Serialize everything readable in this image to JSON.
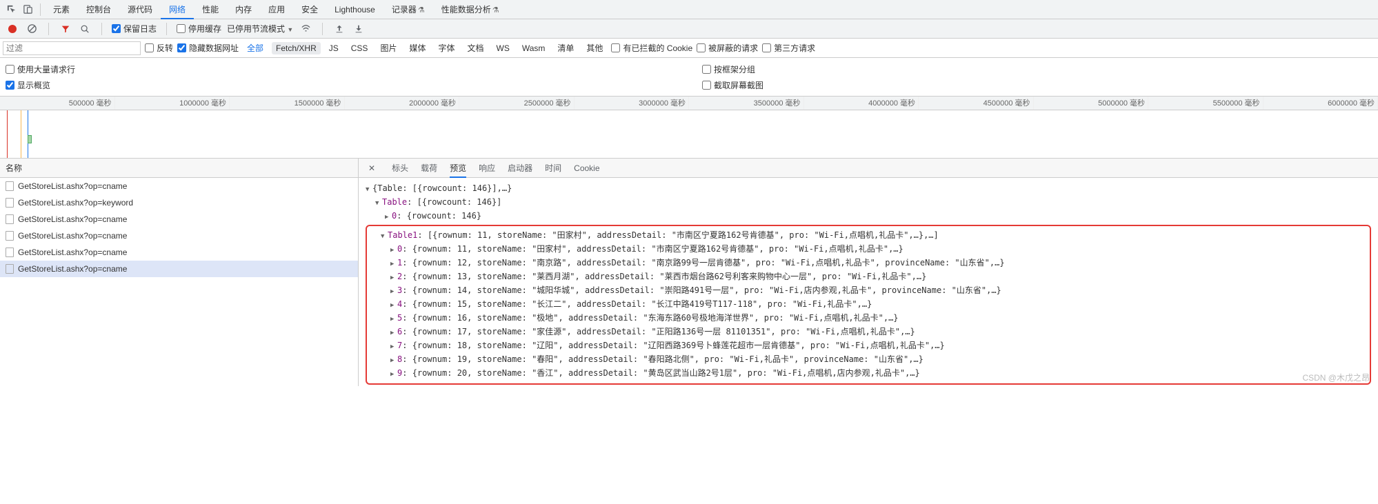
{
  "main_tabs": {
    "elements": "元素",
    "console": "控制台",
    "sources": "源代码",
    "network": "网络",
    "performance": "性能",
    "memory": "内存",
    "application": "应用",
    "security": "安全",
    "lighthouse": "Lighthouse",
    "recorder": "记录器",
    "perfinsights": "性能数据分析"
  },
  "subbar": {
    "preserve_log": "保留日志",
    "disable_cache": "停用缓存",
    "throttling": "已停用节流模式"
  },
  "filterbar": {
    "placeholder": "过滤",
    "invert": "反转",
    "hide_data_urls": "隐藏数据网址",
    "types": {
      "all": "全部",
      "fetch": "Fetch/XHR",
      "js": "JS",
      "css": "CSS",
      "img": "图片",
      "media": "媒体",
      "font": "字体",
      "doc": "文档",
      "ws": "WS",
      "wasm": "Wasm",
      "manifest": "清单",
      "other": "其他"
    },
    "blocked_cookies": "有已拦截的 Cookie",
    "blocked_requests": "被屏蔽的请求",
    "third_party": "第三方请求"
  },
  "options": {
    "large_rows": "使用大量请求行",
    "show_overview": "显示概览",
    "group_by_frame": "按框架分组",
    "screenshot": "截取屏幕截图"
  },
  "timeline": [
    "500000 毫秒",
    "1000000 毫秒",
    "1500000 毫秒",
    "2000000 毫秒",
    "2500000 毫秒",
    "3000000 毫秒",
    "3500000 毫秒",
    "4000000 毫秒",
    "4500000 毫秒",
    "5000000 毫秒",
    "5500000 毫秒",
    "6000000 毫秒"
  ],
  "left_header": "名称",
  "requests": [
    "GetStoreList.ashx?op=cname",
    "GetStoreList.ashx?op=keyword",
    "GetStoreList.ashx?op=cname",
    "GetStoreList.ashx?op=cname",
    "GetStoreList.ashx?op=cname",
    "GetStoreList.ashx?op=cname"
  ],
  "selected_request_index": 5,
  "detail_tabs": {
    "headers": "标头",
    "payload": "载荷",
    "preview": "预览",
    "response": "响应",
    "initiator": "启动器",
    "timing": "时间",
    "cookies": "Cookie"
  },
  "preview": {
    "root_summary": "{Table: [{rowcount: 146}],…}",
    "table_key": "Table",
    "table_summary": "[{rowcount: 146}]",
    "table_row0": "{rowcount: 146}",
    "table1_key": "Table1",
    "table1_summary": "[{rownum: 11, storeName: \"田家村\", addressDetail: \"市南区宁夏路162号肯德基\", pro: \"Wi-Fi,点唱机,礼品卡\",…},…]",
    "rows": [
      "{rownum: 11, storeName: \"田家村\", addressDetail: \"市南区宁夏路162号肯德基\", pro: \"Wi-Fi,点唱机,礼品卡\",…}",
      "{rownum: 12, storeName: \"南京路\", addressDetail: \"南京路99号一层肯德基\", pro: \"Wi-Fi,点唱机,礼品卡\", provinceName: \"山东省\",…}",
      "{rownum: 13, storeName: \"莱西月湖\", addressDetail: \"莱西市烟台路62号利客来购物中心一层\", pro: \"Wi-Fi,礼品卡\",…}",
      "{rownum: 14, storeName: \"城阳华城\", addressDetail: \"崇阳路491号一层\", pro: \"Wi-Fi,店内参观,礼品卡\", provinceName: \"山东省\",…}",
      "{rownum: 15, storeName: \"长江二\", addressDetail: \"长江中路419号T117-118\", pro: \"Wi-Fi,礼品卡\",…}",
      "{rownum: 16, storeName: \"极地\", addressDetail: \"东海东路60号极地海洋世界\", pro: \"Wi-Fi,点唱机,礼品卡\",…}",
      "{rownum: 17, storeName: \"家佳源\", addressDetail: \"正阳路136号一层 81101351\", pro: \"Wi-Fi,点唱机,礼品卡\",…}",
      "{rownum: 18, storeName: \"辽阳\", addressDetail: \"辽阳西路369号卜蜂莲花超市一层肯德基\", pro: \"Wi-Fi,点唱机,礼品卡\",…}",
      "{rownum: 19, storeName: \"春阳\", addressDetail: \"春阳路北侧\", pro: \"Wi-Fi,礼品卡\", provinceName: \"山东省\",…}",
      "{rownum: 20, storeName: \"香江\", addressDetail: \"黄岛区武当山路2号1层\", pro: \"Wi-Fi,点唱机,店内参观,礼品卡\",…}"
    ]
  },
  "watermark": "CSDN @木戊之昂"
}
